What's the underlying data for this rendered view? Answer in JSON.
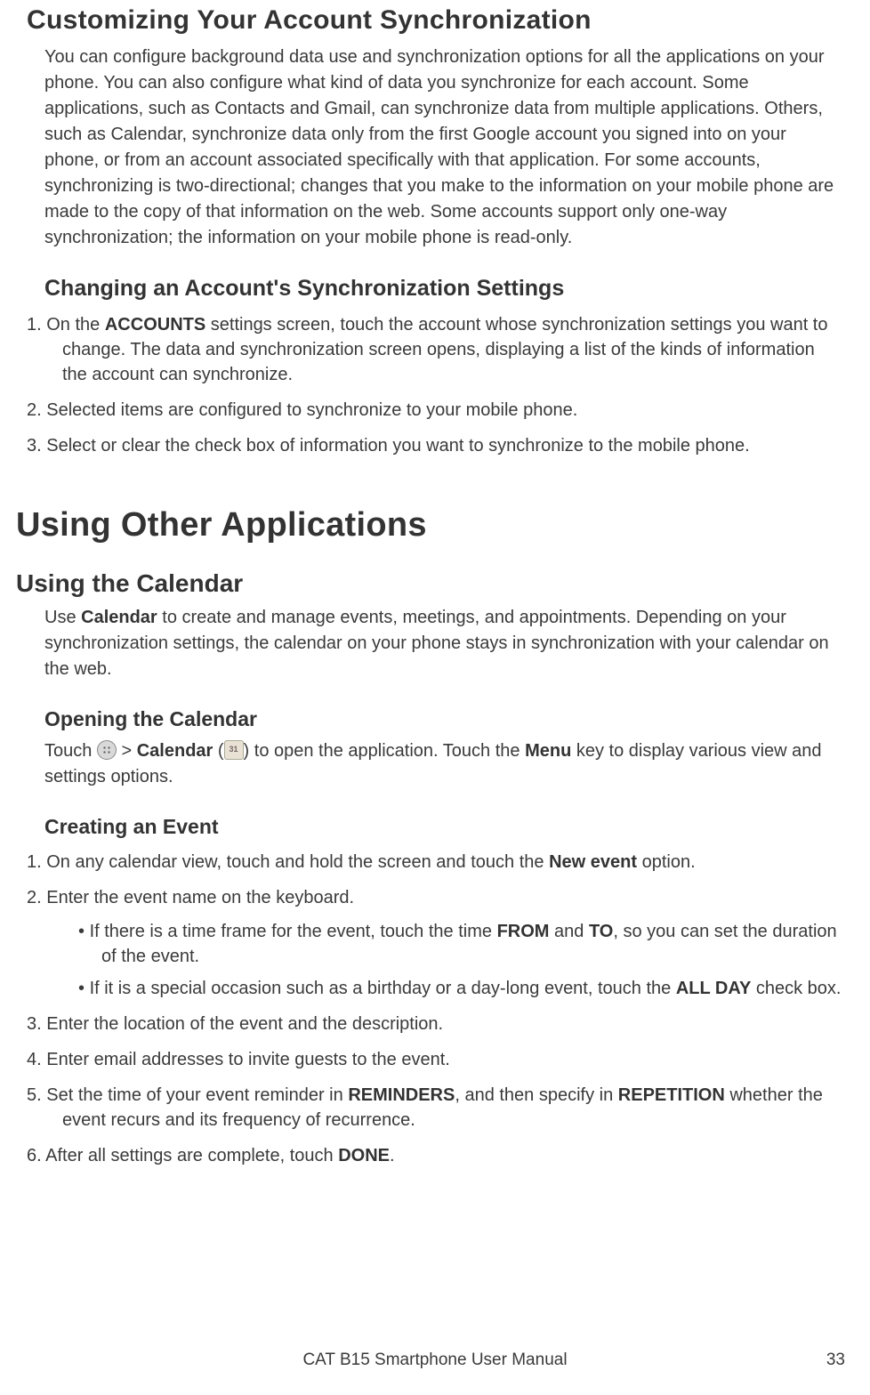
{
  "s1": {
    "h": "Customizing Your Account Synchronization",
    "p": "You can configure background data use and synchronization options for all the applications on your phone. You can also configure what kind of data you synchronize for each account. Some applications, such as Contacts and Gmail, can synchronize data from multiple applications. Others, such as Calendar, synchronize data only from the first Google account you signed into on your phone, or from an account associated specifically with that application. For some accounts, synchronizing is two-directional; changes that you make to the information on your mobile phone are made to the copy of that information on the web. Some accounts support only one-way synchronization; the information on your mobile phone is read-only."
  },
  "s2": {
    "h": "Changing an Account's Synchronization Settings",
    "li1a": "On the ",
    "li1_bold": "ACCOUNTS",
    "li1b": " settings screen, touch the account whose synchronization settings you want to change. The data and synchronization screen opens, displaying a list of the kinds of information the account can synchronize.",
    "li2": "Selected items are configured to synchronize to your mobile phone.",
    "li3": "Select or clear the check box of information you want to synchronize to the mobile phone."
  },
  "s3": {
    "h": "Using Other Applications"
  },
  "s4": {
    "h": "Using the Calendar",
    "p_a": "Use ",
    "p_bold": "Calendar",
    "p_b": " to create and manage events, meetings, and appointments. Depending on your synchronization settings, the calendar on your phone stays in synchronization with your calendar on the web."
  },
  "s5": {
    "h": "Opening the Calendar",
    "p_a": "Touch ",
    "gt": " > ",
    "p_bold1": "Calendar",
    "p_mid": " (",
    "p_close": ") to open the application. Touch the ",
    "p_bold2": "Menu",
    "p_end": " key to display various view and settings options."
  },
  "s6": {
    "h": "Creating an Event",
    "li1a": "On any calendar view, touch and hold the screen and touch the ",
    "li1_bold": "New event",
    "li1b": " option.",
    "li2": "Enter the event name on the keyboard.",
    "sub1a": "If there is a time frame for the event, touch the time ",
    "sub1_bold1": "FROM",
    "sub1_mid": " and ",
    "sub1_bold2": "TO",
    "sub1b": ", so you can set the duration of the event.",
    "sub2a": "If it is a special occasion such as a birthday or a day-long event, touch the ",
    "sub2_bold": "ALL DAY",
    "sub2b": " check box.",
    "li3": "Enter the location of the event and the description.",
    "li4": "Enter email addresses to invite guests to the event.",
    "li5a": "Set the time of your event reminder in ",
    "li5_bold1": "REMINDERS",
    "li5_mid": ", and then specify in ",
    "li5_bold2": "REPETITION",
    "li5b": " whether the event recurs and its frequency of recurrence.",
    "li6a": "After all settings are complete, touch ",
    "li6_bold": "DONE",
    "li6b": "."
  },
  "footer": {
    "title": "CAT B15 Smartphone User Manual",
    "page": "33"
  }
}
